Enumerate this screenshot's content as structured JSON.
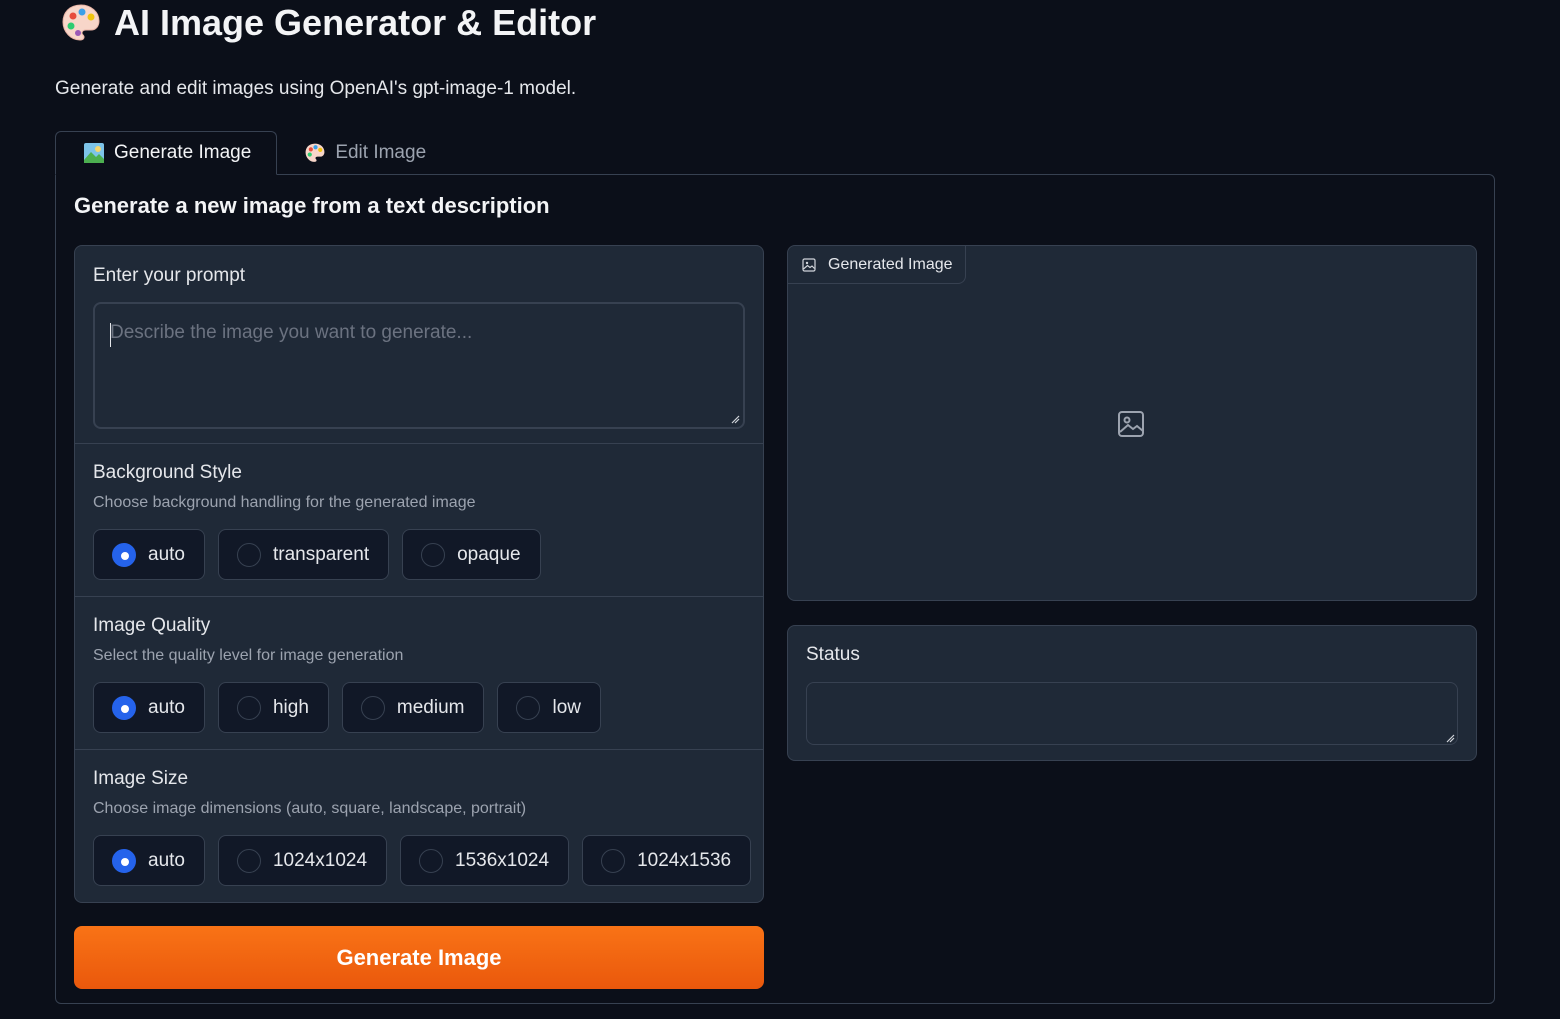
{
  "app": {
    "title": "AI Image Generator & Editor",
    "subtitle": "Generate and edit images using OpenAI's gpt-image-1 model.",
    "title_icon": "palette-icon"
  },
  "tabs": [
    {
      "label": "Generate Image",
      "icon": "picture-icon",
      "active": true
    },
    {
      "label": "Edit Image",
      "icon": "palette-icon",
      "active": false
    }
  ],
  "generate": {
    "heading": "Generate a new image from a text description",
    "prompt": {
      "label": "Enter your prompt",
      "placeholder": "Describe the image you want to generate...",
      "value": ""
    },
    "background": {
      "label": "Background Style",
      "info": "Choose background handling for the generated image",
      "options": [
        "auto",
        "transparent",
        "opaque"
      ],
      "selected": "auto"
    },
    "quality": {
      "label": "Image Quality",
      "info": "Select the quality level for image generation",
      "options": [
        "auto",
        "high",
        "medium",
        "low"
      ],
      "selected": "auto"
    },
    "size": {
      "label": "Image Size",
      "info": "Choose image dimensions (auto, square, landscape, portrait)",
      "options": [
        "auto",
        "1024x1024",
        "1536x1024",
        "1024x1536"
      ],
      "selected": "auto"
    },
    "button_label": "Generate Image"
  },
  "output": {
    "image_label": "Generated Image",
    "image_icon": "image-icon",
    "placeholder_icon": "image-placeholder-icon",
    "status_label": "Status",
    "status_value": ""
  },
  "colors": {
    "background": "#0b0f19",
    "panel": "#1f2937",
    "border": "#374151",
    "accent_radio": "#2563eb",
    "primary_button": "#f97316"
  }
}
